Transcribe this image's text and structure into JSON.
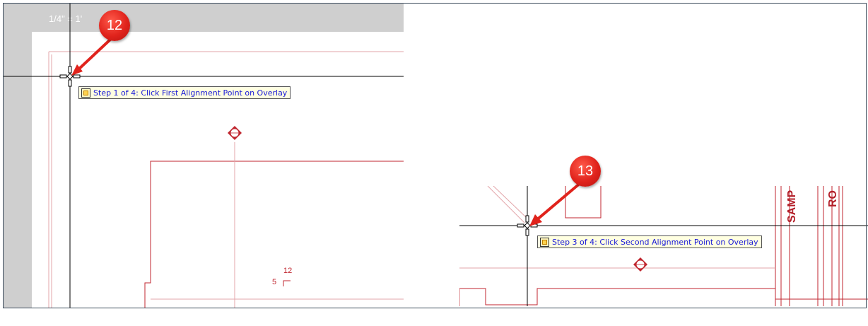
{
  "left_panel": {
    "scale_label": "1/4\" = 1'",
    "tooltip": "Step 1 of 4: Click First Alignment Point on Overlay",
    "callout_number": "12",
    "dimension": {
      "value": "12",
      "label": "5"
    }
  },
  "right_panel": {
    "tooltip": "Step 3 of 4: Click Second Alignment Point on Overlay",
    "callout_number": "13",
    "room_labels": [
      "SAMP",
      "RO"
    ]
  },
  "colors": {
    "callout": "#e0231c",
    "drawing_lines": "#c0262f",
    "tooltip_bg": "#ffffe1",
    "tooltip_text": "#1a1ad8"
  },
  "icons": [
    "crosshair-cursor-icon",
    "overlay-tool-icon",
    "section-marker-icon"
  ]
}
